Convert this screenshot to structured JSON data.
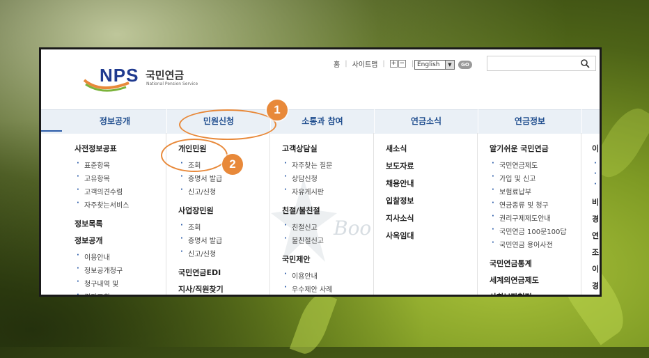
{
  "header": {
    "logo_main": "NPS",
    "logo_korean": "국민연금",
    "logo_english": "National Pension Service",
    "links": [
      "홈",
      "사이트맵"
    ],
    "font_plus": "+",
    "font_minus": "−",
    "language": "English",
    "go_label": "GO",
    "search_placeholder": ""
  },
  "nav": {
    "tabs": [
      "정보공개",
      "민원신청",
      "소통과 참여",
      "연금소식",
      "연금정보"
    ]
  },
  "menu": {
    "col1": {
      "section1": "사전정보공표",
      "section1_items": [
        "표준항목",
        "고유항목",
        "고객의견수렴",
        "자주찾는서비스"
      ],
      "section2": "정보목록",
      "section3": "정보공개",
      "section3_items": [
        "이용안내",
        "정보공개청구",
        "청구내역 및",
        "결과조회"
      ]
    },
    "col2": {
      "section1": "개인민원",
      "section1_items": [
        "조회",
        "증명서 발급",
        "신고/신청"
      ],
      "section2": "사업장민원",
      "section2_items": [
        "조회",
        "증명서 발급",
        "신고/신청"
      ],
      "section3": "국민연금EDI",
      "section4": "지사/직원찾기"
    },
    "col3": {
      "section1": "고객상담실",
      "section1_items": [
        "자주찾는 질문",
        "상담신청",
        "자유게시판"
      ],
      "section2": "친절/불친절",
      "section2_items": [
        "친절신고",
        "불친절신고"
      ],
      "section3": "국민제안",
      "section3_items": [
        "이용안내",
        "우수제안 사례"
      ]
    },
    "col4": {
      "items": [
        "새소식",
        "보도자료",
        "채용안내",
        "입찰정보",
        "지사소식",
        "사옥임대"
      ]
    },
    "col5": {
      "section1": "알기쉬운 국민연금",
      "section1_items": [
        "국민연금제도",
        "가입 및 신고",
        "보험료납부",
        "연금종류 및 청구",
        "권리구제제도안내",
        "국민연금 100문100답",
        "국민연금 용어사전"
      ],
      "section2": "국민연금통계",
      "section3": "세계의연금제도",
      "section4": "사회보장협정"
    },
    "col6": {
      "partial": [
        "이",
        "비",
        "경",
        "연",
        "조",
        "이",
        "경"
      ]
    }
  },
  "watermark": "Boo",
  "annotations": {
    "badge1": "1",
    "badge2": "2",
    "accent_color": "#e8893a"
  },
  "colors": {
    "nav_text": "#1f4d8e",
    "nav_bg": "#eaf0f6",
    "logo_blue": "#1f3a8f"
  }
}
